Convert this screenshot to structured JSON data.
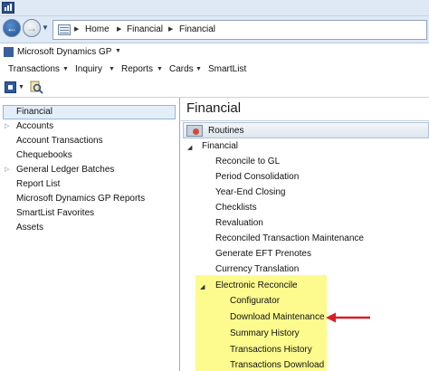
{
  "window": {
    "app_icon": "dynamics-gp-icon"
  },
  "address_bar": {
    "breadcrumbs": [
      "Home",
      "Financial",
      "Financial"
    ]
  },
  "company": {
    "name": "Microsoft Dynamics GP"
  },
  "menu": {
    "items": [
      "Transactions",
      "Inquiry",
      "Reports",
      "Cards",
      "SmartList"
    ]
  },
  "navigation_pane": {
    "selected": "Financial",
    "items": [
      "Financial",
      "Accounts",
      "Account Transactions",
      "Chequebooks",
      "General Ledger Batches",
      "Report List",
      "Microsoft Dynamics GP Reports",
      "SmartList Favorites",
      "Assets"
    ]
  },
  "content_pane": {
    "title": "Financial",
    "section": "Routines",
    "group": "Financial",
    "routines": [
      "Reconcile to GL",
      "Period Consolidation",
      "Year-End Closing",
      "Checklists",
      "Revaluation",
      "Reconciled Transaction Maintenance",
      "Generate EFT Prenotes",
      "Currency Translation"
    ],
    "subgroup": "Electronic Reconcile",
    "subgroup_items": [
      "Configurator",
      "Download Maintenance",
      "Summary History",
      "Transactions History",
      "Transactions Download"
    ],
    "highlighted_item": "Download Maintenance"
  },
  "colors": {
    "highlight": "#fdfb8e",
    "arrow": "#d81f26",
    "selection": "#e4eef9"
  }
}
